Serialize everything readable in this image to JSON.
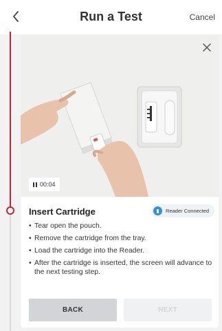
{
  "header": {
    "title": "Run a Test",
    "cancel_label": "Cancel",
    "back_icon": "chevron-left-icon"
  },
  "video": {
    "timer": "00:04",
    "pause_icon": "pause-icon"
  },
  "step": {
    "title": "Insert Cartridge",
    "reader_status": "Reader Connected",
    "bullets": [
      "Tear open the pouch.",
      "Remove the cartridge from the tray.",
      "Load the cartridge into the Reader.",
      "After the cartridge is inserted, the screen will advance to the next testing step."
    ]
  },
  "buttons": {
    "back": "BACK",
    "next": "NEXT",
    "next_enabled": false
  },
  "colors": {
    "accent": "#d11f30",
    "reader_blue": "#2f8fe0",
    "back_button": "#d2d4d8",
    "next_button_disabled": "#f0f1f2"
  }
}
